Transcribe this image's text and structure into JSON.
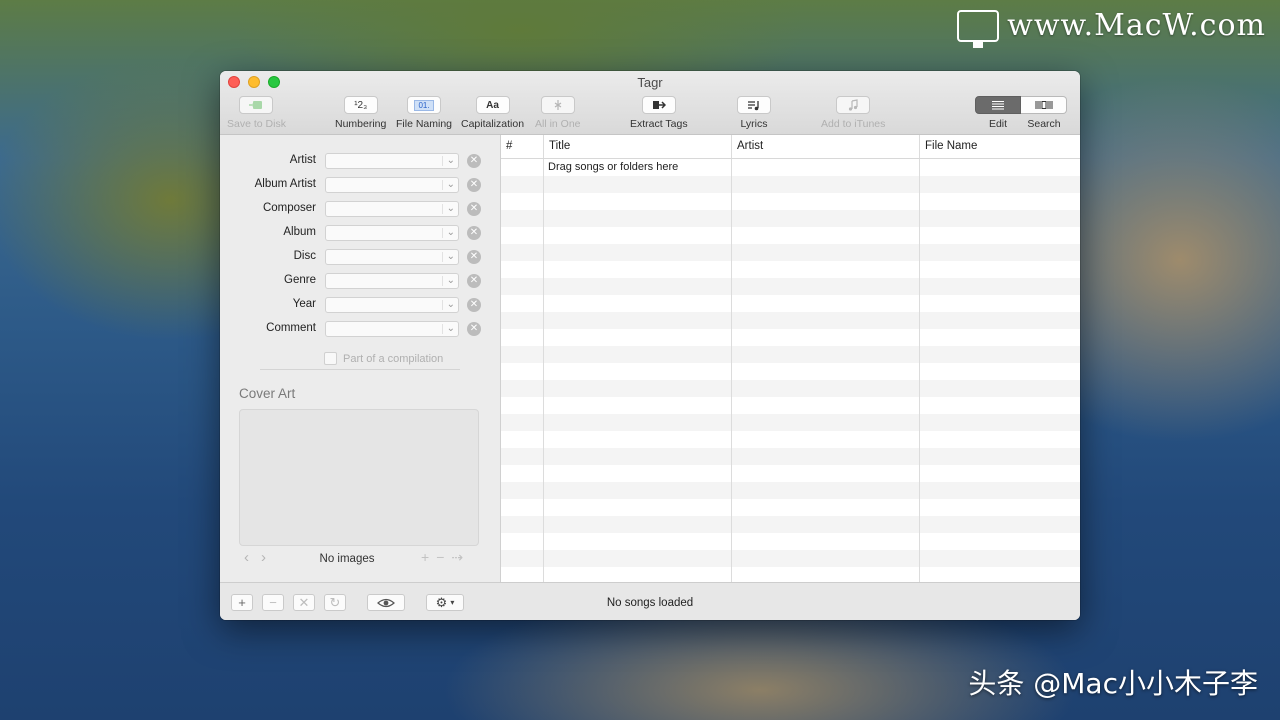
{
  "desktop": {
    "watermark_top": "www.MacW.com",
    "watermark_bottom": "头条 @Mac小小木子李"
  },
  "window": {
    "title": "Tagr"
  },
  "toolbar": {
    "save_to_disk": "Save to Disk",
    "numbering": "Numbering",
    "file_naming": "File Naming",
    "capitalization": "Capitalization",
    "all_in_one": "All in One",
    "extract_tags": "Extract Tags",
    "lyrics": "Lyrics",
    "add_to_itunes": "Add to iTunes",
    "edit": "Edit",
    "search": "Search",
    "numbering_glyph": "¹2₃",
    "file_naming_glyph": "01.",
    "capitalization_glyph": "Aa"
  },
  "tag_fields": [
    {
      "label": "Artist",
      "value": ""
    },
    {
      "label": "Album Artist",
      "value": ""
    },
    {
      "label": "Composer",
      "value": ""
    },
    {
      "label": "Album",
      "value": ""
    },
    {
      "label": "Disc",
      "value": ""
    },
    {
      "label": "Genre",
      "value": ""
    },
    {
      "label": "Year",
      "value": ""
    },
    {
      "label": "Comment",
      "value": ""
    }
  ],
  "compilation_label": "Part of a compilation",
  "cover_art": {
    "title": "Cover Art",
    "empty_text": "No images"
  },
  "table": {
    "columns": [
      "#",
      "Title",
      "Artist",
      "File Name"
    ],
    "placeholder": "Drag songs or folders here"
  },
  "status": "No songs loaded"
}
